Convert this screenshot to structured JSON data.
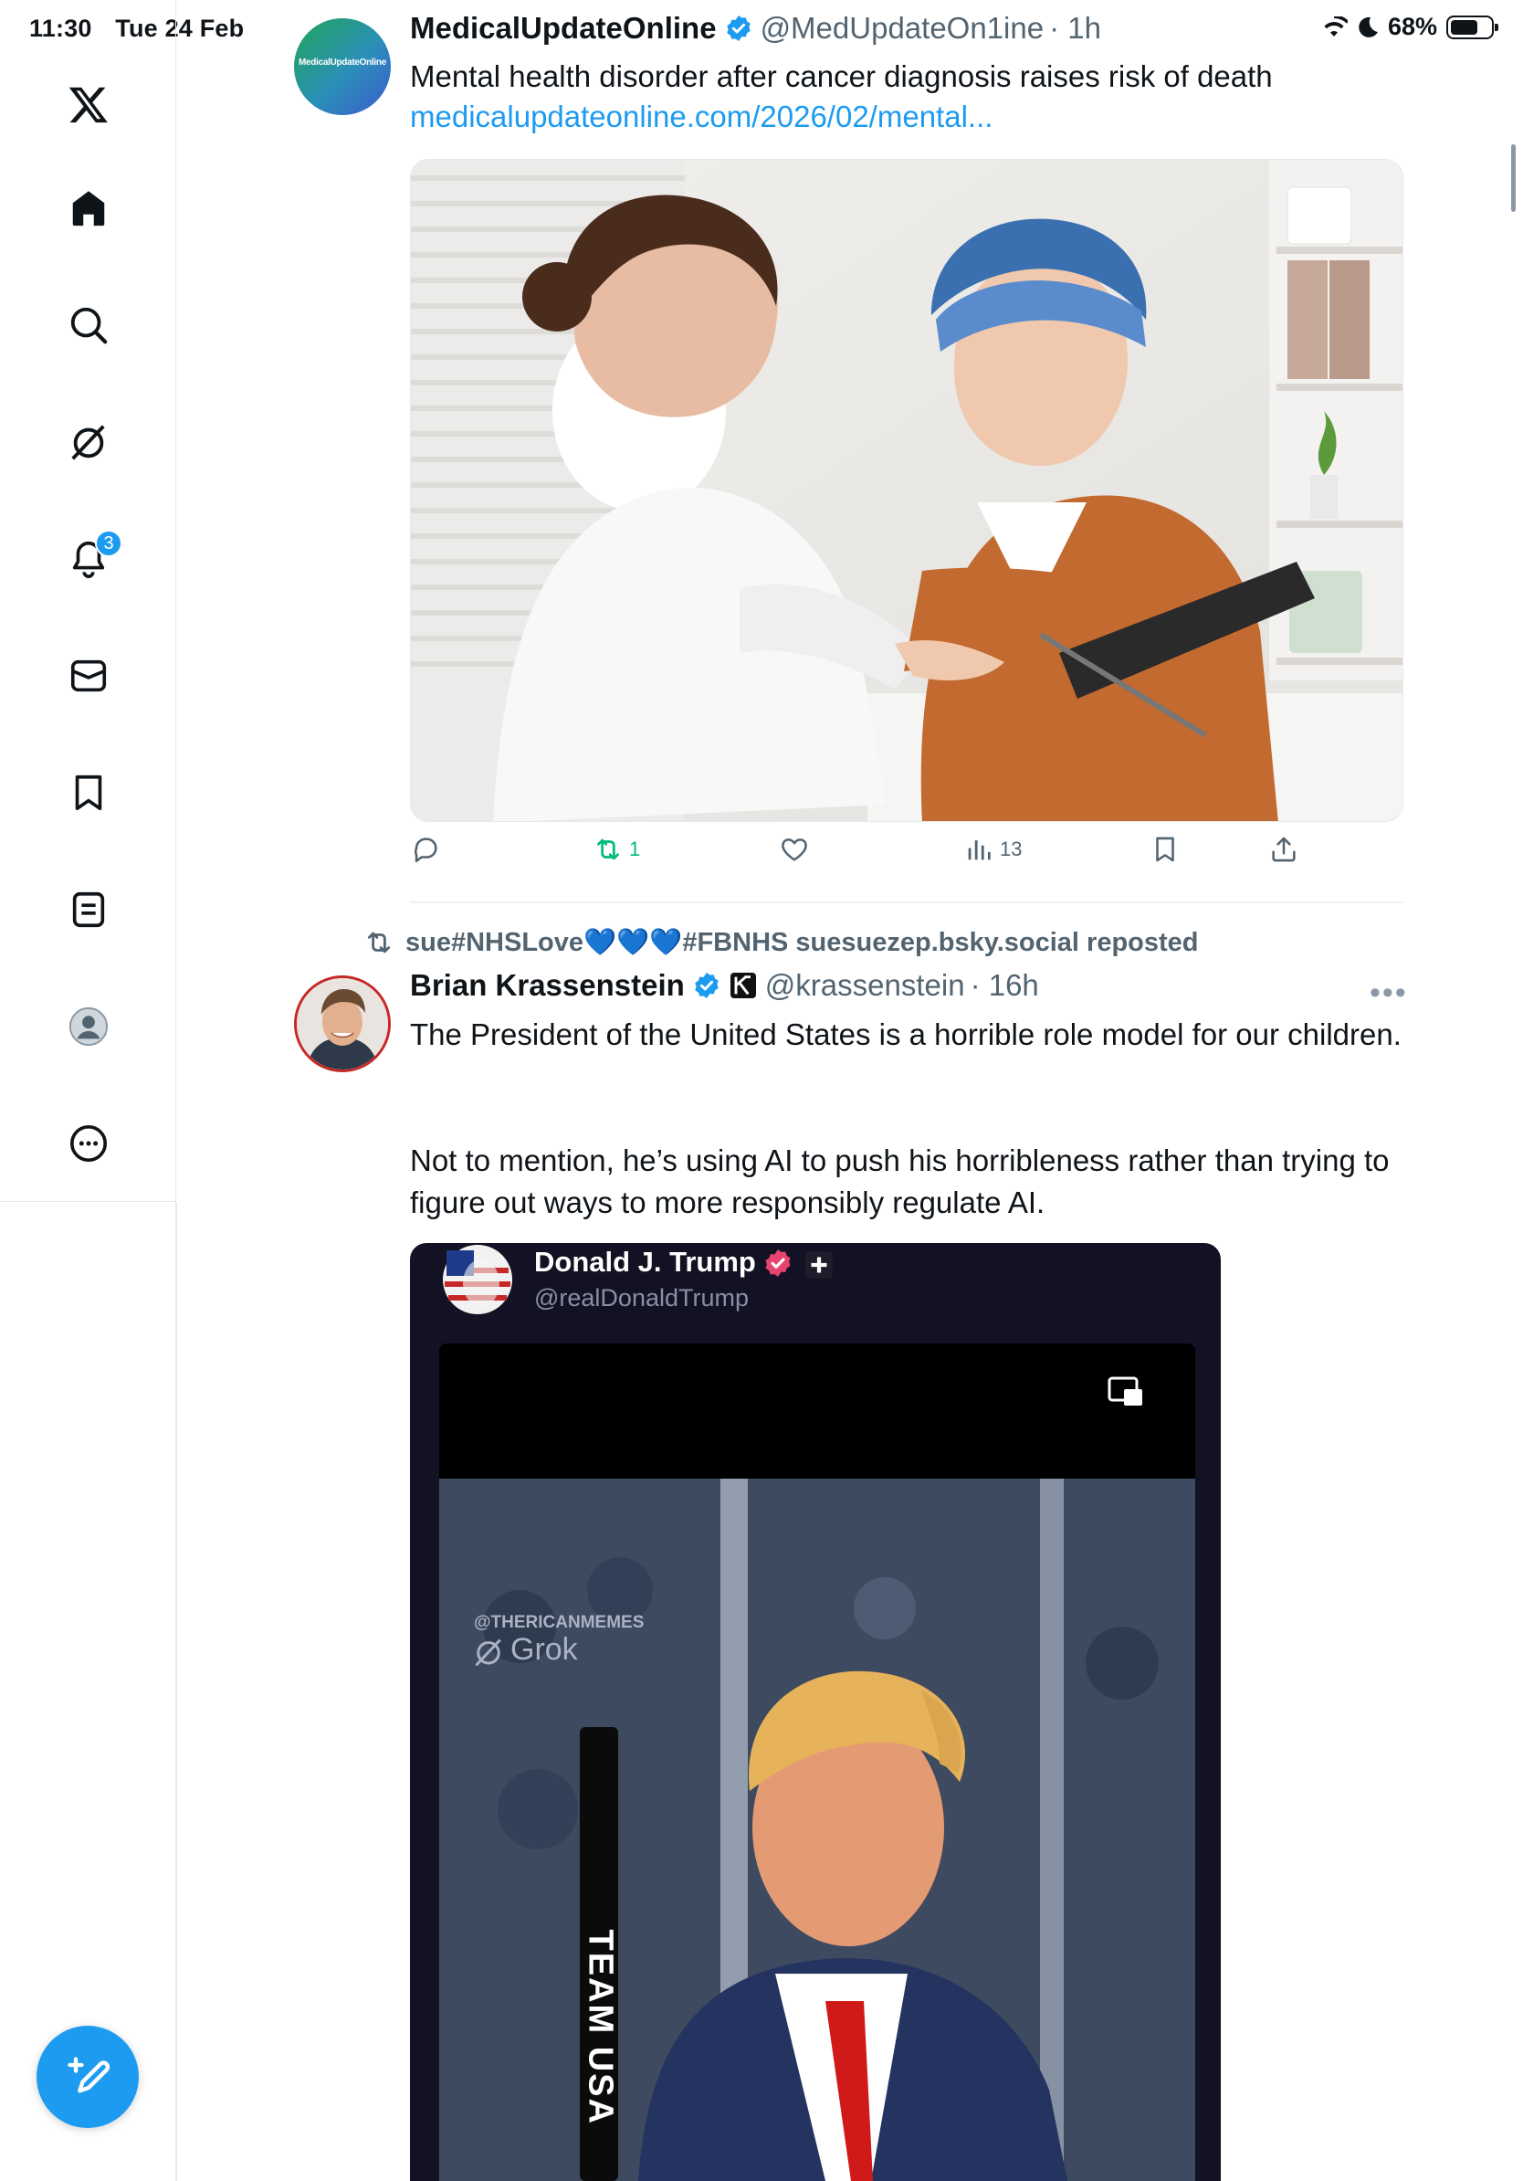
{
  "status_bar": {
    "time": "11:30",
    "date": "Tue 24 Feb",
    "battery": "68%",
    "battery_level": 0.68
  },
  "sidebar": {
    "items": [
      {
        "icon": "x-logo-icon"
      },
      {
        "icon": "home-icon"
      },
      {
        "icon": "search-icon"
      },
      {
        "icon": "grok-icon"
      },
      {
        "icon": "bell-icon",
        "badge": "3"
      },
      {
        "icon": "mail-icon"
      },
      {
        "icon": "bookmark-icon"
      },
      {
        "icon": "list-icon"
      },
      {
        "icon": "profile-icon"
      },
      {
        "icon": "more-circle-icon"
      }
    ],
    "compose_icon": "compose-icon"
  },
  "tweets": [
    {
      "avatar_text": "MedicalUpdateOnline",
      "name": "MedicalUpdateOnline",
      "handle": "@MedUpdateOn1ine",
      "time": "· 1h",
      "text": "Mental health disorder after cancer diagnosis raises risk of death",
      "link": "medicalupdateonline.com/2026/02/mental...",
      "image_description": "Doctor talking with a cancer patient wearing a blue headscarf",
      "actions": {
        "reply": "",
        "retweets": "1",
        "likes": "",
        "views": "13"
      }
    },
    {
      "repost_label": "sue#NHSLove💙💙💙#FBNHS suesuezep.bsky.social reposted",
      "name": "Brian Krassenstein",
      "handle": "@krassenstein",
      "time": "· 16h",
      "text_lines": [
        "The President of the United States is a horrible role model for our children.",
        "Not to mention, he’s using AI to push his horribleness rather than trying to figure out ways to more responsibly regulate AI."
      ],
      "embedded": {
        "name": "Donald J. Trump",
        "handle": "@realDonaldTrump",
        "watermark_1": "@THERICANMEMES",
        "watermark_2": "Grok",
        "stick_text": "TEAM USA"
      }
    }
  ],
  "colors": {
    "accent": "#1d9bf0",
    "retweet_green": "#00ba7c",
    "muted": "#536471"
  }
}
